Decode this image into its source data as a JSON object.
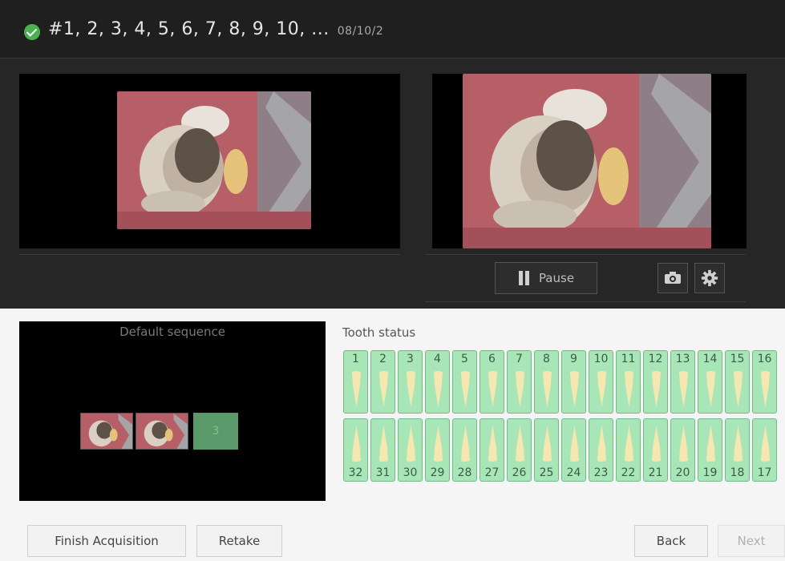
{
  "header": {
    "title": "#1, 2, 3, 4, 5, 6, 7, 8, 9, 10, ...",
    "date": "08/10/2",
    "status_icon": "check-circle-icon",
    "status_color": "#4caf50"
  },
  "preview": {
    "pause_label": "Pause",
    "camera_icon": "camera-icon",
    "settings_icon": "gear-icon"
  },
  "sequence": {
    "title": "Default sequence",
    "placeholder_label": "3"
  },
  "tooth_status": {
    "label": "Tooth status",
    "upper_row": [
      "1",
      "2",
      "3",
      "4",
      "5",
      "6",
      "7",
      "8",
      "9",
      "10",
      "11",
      "12",
      "13",
      "14",
      "15",
      "16"
    ],
    "lower_row": [
      "32",
      "31",
      "30",
      "29",
      "28",
      "27",
      "26",
      "25",
      "24",
      "23",
      "22",
      "21",
      "20",
      "19",
      "18",
      "17"
    ],
    "fill_color": "#a8e6b8"
  },
  "footer": {
    "finish_label": "Finish Acquisition",
    "retake_label": "Retake",
    "back_label": "Back",
    "next_label": "Next"
  }
}
